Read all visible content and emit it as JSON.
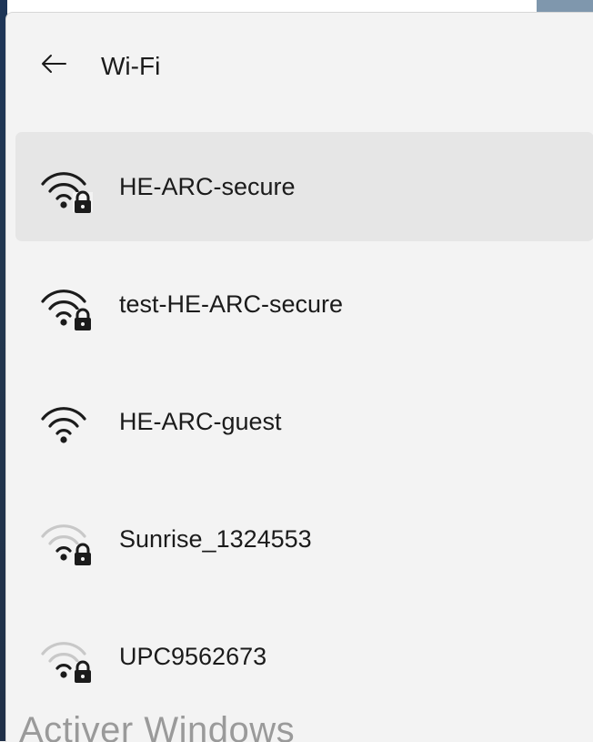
{
  "header": {
    "back_icon": "arrow-left-icon",
    "title": "Wi-Fi"
  },
  "networks": [
    {
      "name": "HE-ARC-secure",
      "icon": "wifi-lock-icon",
      "signal_bars": 3,
      "secured": true,
      "selected": true
    },
    {
      "name": "test-HE-ARC-secure",
      "icon": "wifi-lock-icon",
      "signal_bars": 3,
      "secured": true,
      "selected": false
    },
    {
      "name": "HE-ARC-guest",
      "icon": "wifi-icon",
      "signal_bars": 3,
      "secured": false,
      "selected": false
    },
    {
      "name": "Sunrise_1324553",
      "icon": "wifi-lock-icon",
      "signal_bars": 1,
      "secured": true,
      "selected": false
    },
    {
      "name": "UPC9562673",
      "icon": "wifi-lock-icon",
      "signal_bars": 1,
      "secured": true,
      "selected": false
    }
  ],
  "watermark": "Activer Windows",
  "colors": {
    "panel_bg": "#f3f3f3",
    "selected_bg": "#e6e6e6",
    "text": "#1b1b1b",
    "signal_active": "#1b1b1b",
    "signal_inactive": "#c8c8c8"
  }
}
